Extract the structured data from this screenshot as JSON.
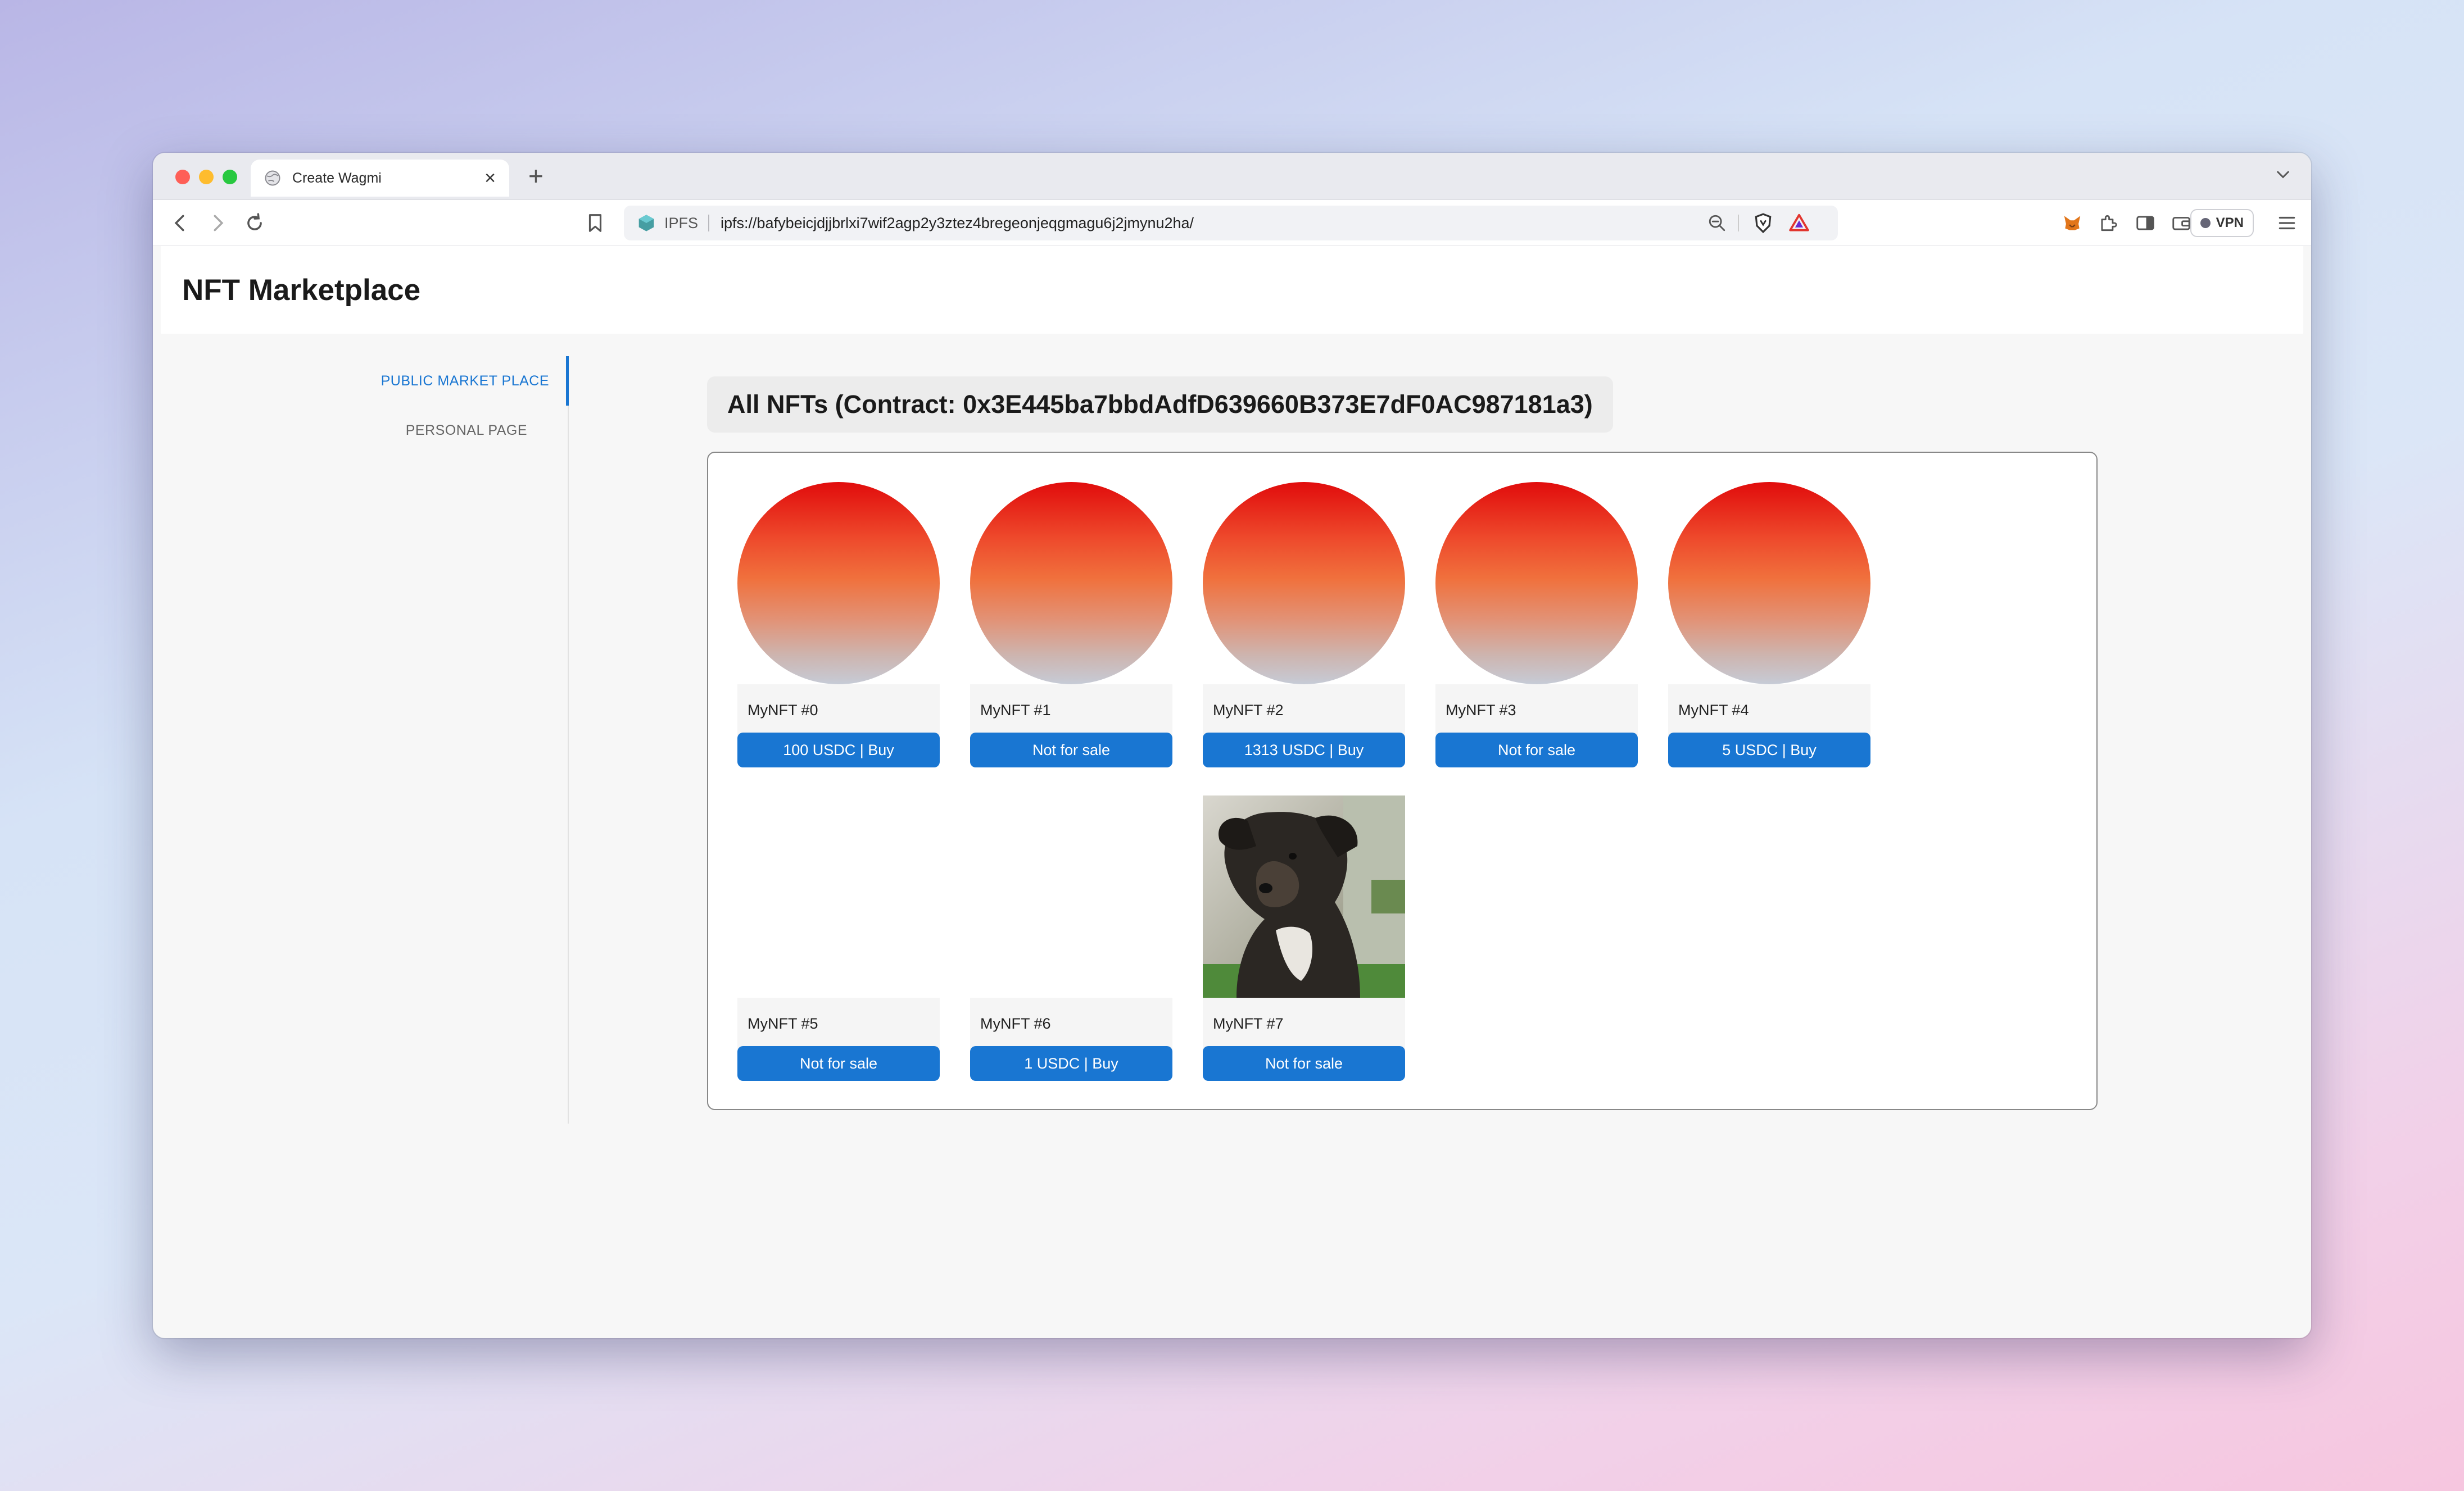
{
  "browser": {
    "tab_title": "Create Wagmi",
    "new_tab_symbol": "+",
    "tab_close_symbol": "×",
    "address_prefix": "IPFS",
    "url": "ipfs://bafybeicjdjjbrlxi7wif2agp2y3ztez4bregeonjeqgmagu6j2jmynu2ha/",
    "vpn_label": "VPN"
  },
  "header": {
    "title": "NFT Marketplace"
  },
  "nav": {
    "items": [
      {
        "label": "PUBLIC MARKET PLACE",
        "active": true
      },
      {
        "label": "PERSONAL PAGE",
        "active": false
      }
    ]
  },
  "section": {
    "title": "All NFTs (Contract: 0x3E445ba7bbdAdfD639660B373E7dF0AC987181a3)"
  },
  "nfts": [
    {
      "name": "MyNFT #0",
      "button": "100 USDC | Buy",
      "image": "gradient-circle"
    },
    {
      "name": "MyNFT #1",
      "button": "Not for sale",
      "image": "gradient-circle"
    },
    {
      "name": "MyNFT #2",
      "button": "1313 USDC | Buy",
      "image": "gradient-circle"
    },
    {
      "name": "MyNFT #3",
      "button": "Not for sale",
      "image": "gradient-circle"
    },
    {
      "name": "MyNFT #4",
      "button": "5 USDC | Buy",
      "image": "gradient-circle"
    },
    {
      "name": "MyNFT #5",
      "button": "Not for sale",
      "image": "blank"
    },
    {
      "name": "MyNFT #6",
      "button": "1 USDC | Buy",
      "image": "blank"
    },
    {
      "name": "MyNFT #7",
      "button": "Not for sale",
      "image": "dog-photo"
    }
  ],
  "colors": {
    "accent": "#1976d2",
    "button_text": "#ffffff",
    "gradient_top": "#e10c0c",
    "gradient_bottom": "#c6cbd6"
  }
}
